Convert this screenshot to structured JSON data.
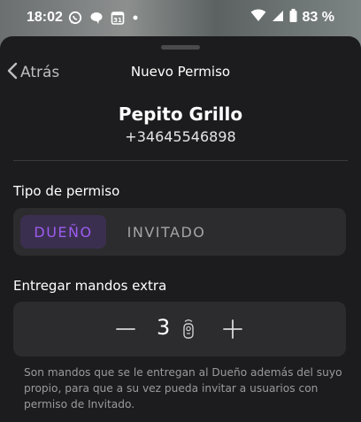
{
  "status_bar": {
    "time": "18:02",
    "battery": "83 %",
    "icons": [
      "whatsapp-icon",
      "chat-bubble-icon",
      "calendar-icon",
      "notification-dot-icon",
      "wifi-icon",
      "signal-icon",
      "battery-icon"
    ],
    "calendar_day": "31"
  },
  "nav": {
    "back_label": "Atrás",
    "title": "Nuevo Permiso"
  },
  "contact": {
    "name": "Pepito Grillo",
    "phone": "+34645546898"
  },
  "permission_type": {
    "label": "Tipo de permiso",
    "options": [
      "DUEÑO",
      "INVITADO"
    ],
    "selected": "DUEÑO"
  },
  "extra_remotes": {
    "label": "Entregar mandos extra",
    "value": "3",
    "help": "Son mandos que se le entregan al Dueño además del suyo propio, para que a su vez pueda invitar a usuarios con permiso de Invitado."
  },
  "colors": {
    "accent": "#9d5cf0",
    "sheet_bg": "#1c1c1e",
    "control_bg": "#2c2c2e"
  }
}
